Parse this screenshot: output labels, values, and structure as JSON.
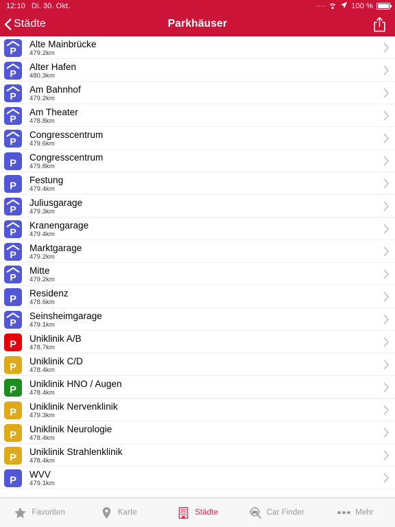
{
  "status_bar": {
    "time": "12:10",
    "date": "Di. 30. Okt.",
    "battery_percent": "100 %",
    "signal_icon": "signal-dots-icon",
    "wifi_icon": "wifi-icon",
    "location_icon": "location-arrow-icon",
    "battery_icon": "battery-full-icon"
  },
  "navbar": {
    "back_label": "Städte",
    "back_icon": "chevron-left-icon",
    "title": "Parkhäuser",
    "share_icon": "share-icon",
    "background_color": "#CC1439"
  },
  "list": {
    "disclosure_icon": "chevron-right-icon",
    "rows": [
      {
        "name": "Alte Mainbrücke",
        "distance": "479.2km",
        "icon": "parking-garage-icon",
        "color": "#5257D6"
      },
      {
        "name": "Alter Hafen",
        "distance": "480.3km",
        "icon": "parking-garage-icon",
        "color": "#5257D6"
      },
      {
        "name": "Am Bahnhof",
        "distance": "479.2km",
        "icon": "parking-garage-icon",
        "color": "#5257D6"
      },
      {
        "name": "Am Theater",
        "distance": "478.8km",
        "icon": "parking-garage-icon",
        "color": "#5257D6"
      },
      {
        "name": "Congresscentrum",
        "distance": "479.6km",
        "icon": "parking-garage-icon",
        "color": "#5257D6"
      },
      {
        "name": "Congresscentrum",
        "distance": "479.8km",
        "icon": "parking-lot-icon",
        "color": "#5257D6"
      },
      {
        "name": "Festung",
        "distance": "479.4km",
        "icon": "parking-lot-icon",
        "color": "#5257D6"
      },
      {
        "name": "Juliusgarage",
        "distance": "479.3km",
        "icon": "parking-garage-icon",
        "color": "#5257D6"
      },
      {
        "name": "Kranengarage",
        "distance": "479.4km",
        "icon": "parking-garage-icon",
        "color": "#5257D6"
      },
      {
        "name": "Marktgarage",
        "distance": "479.2km",
        "icon": "parking-garage-icon",
        "color": "#5257D6"
      },
      {
        "name": "Mitte",
        "distance": "479.2km",
        "icon": "parking-garage-icon",
        "color": "#5257D6"
      },
      {
        "name": "Residenz",
        "distance": "478.6km",
        "icon": "parking-lot-icon",
        "color": "#5257D6"
      },
      {
        "name": "Seinsheimgarage",
        "distance": "479.1km",
        "icon": "parking-garage-icon",
        "color": "#5257D6"
      },
      {
        "name": "Uniklinik  A/B",
        "distance": "478.7km",
        "icon": "parking-lot-icon",
        "color": "#E3000B"
      },
      {
        "name": "Uniklinik C/D",
        "distance": "478.4km",
        "icon": "parking-lot-icon",
        "color": "#DFA91C"
      },
      {
        "name": "Uniklinik HNO / Augen",
        "distance": "478.4km",
        "icon": "parking-lot-icon",
        "color": "#1D8C21"
      },
      {
        "name": "Uniklinik Nervenklinik",
        "distance": "479.3km",
        "icon": "parking-lot-icon",
        "color": "#DFA91C"
      },
      {
        "name": "Uniklinik Neurologie",
        "distance": "478.4km",
        "icon": "parking-lot-icon",
        "color": "#DFA91C"
      },
      {
        "name": "Uniklinik Strahlenklinik",
        "distance": "478.4km",
        "icon": "parking-lot-icon",
        "color": "#DFA91C"
      },
      {
        "name": "WVV",
        "distance": "479.1km",
        "icon": "parking-lot-icon",
        "color": "#5257D6"
      }
    ]
  },
  "tabbar": {
    "active_color": "#E8254F",
    "inactive_color": "#9A9A9F",
    "tabs": [
      {
        "label": "Favoriten",
        "icon": "star-icon",
        "active": false
      },
      {
        "label": "Karte",
        "icon": "map-pin-icon",
        "active": false
      },
      {
        "label": "Städte",
        "icon": "building-icon",
        "active": true
      },
      {
        "label": "Car Finder",
        "icon": "car-finder-icon",
        "active": false
      },
      {
        "label": "Mehr",
        "icon": "more-dots-icon",
        "active": false
      }
    ]
  }
}
